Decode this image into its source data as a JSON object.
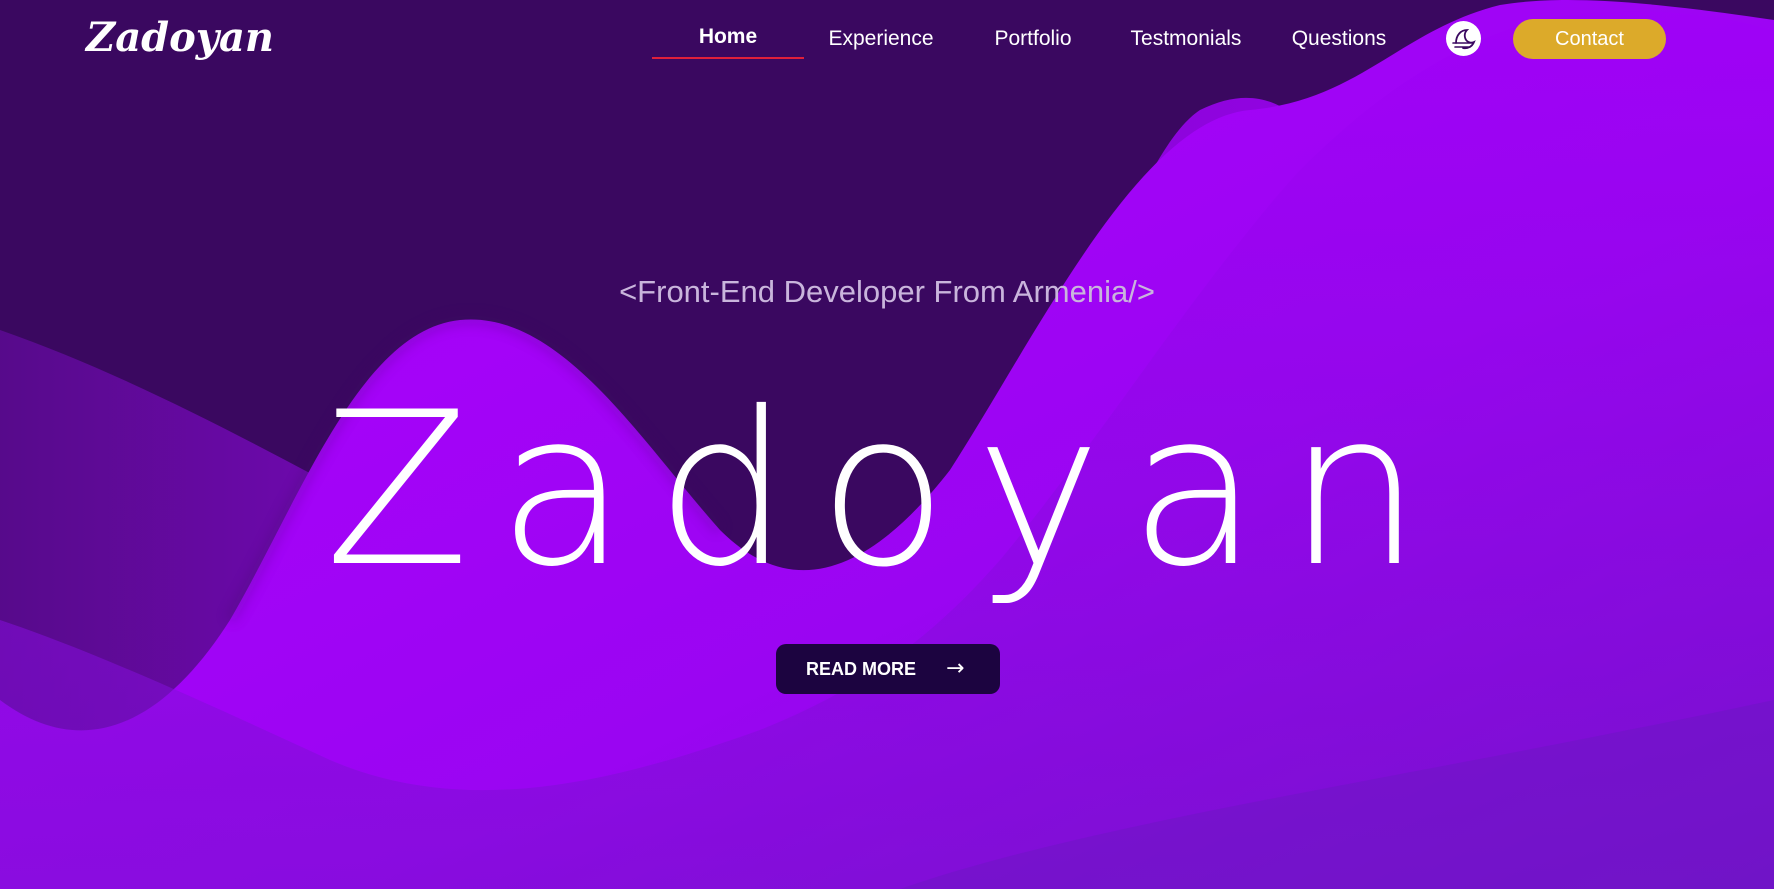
{
  "brand": {
    "logo_text": "Zadoyan"
  },
  "nav": {
    "items": [
      {
        "label": "Home",
        "active": true
      },
      {
        "label": "Experience",
        "active": false
      },
      {
        "label": "Portfolio",
        "active": false
      },
      {
        "label": "Testmonials",
        "active": false
      },
      {
        "label": "Questions",
        "active": false
      }
    ],
    "contact_label": "Contact",
    "theme_icon": "theme-toggle-icon"
  },
  "hero": {
    "subtitle": "<Front-End Developer From Armenia/>",
    "title": "Zadoyan",
    "cta_label": "READ MORE",
    "cta_icon": "arrow-right-icon"
  },
  "colors": {
    "background_dark": "#3a0860",
    "wave_violet": "#a600ff",
    "accent_gold": "#dcaa2a",
    "button_dark": "#1c0440",
    "active_underline": "#e0203a"
  }
}
